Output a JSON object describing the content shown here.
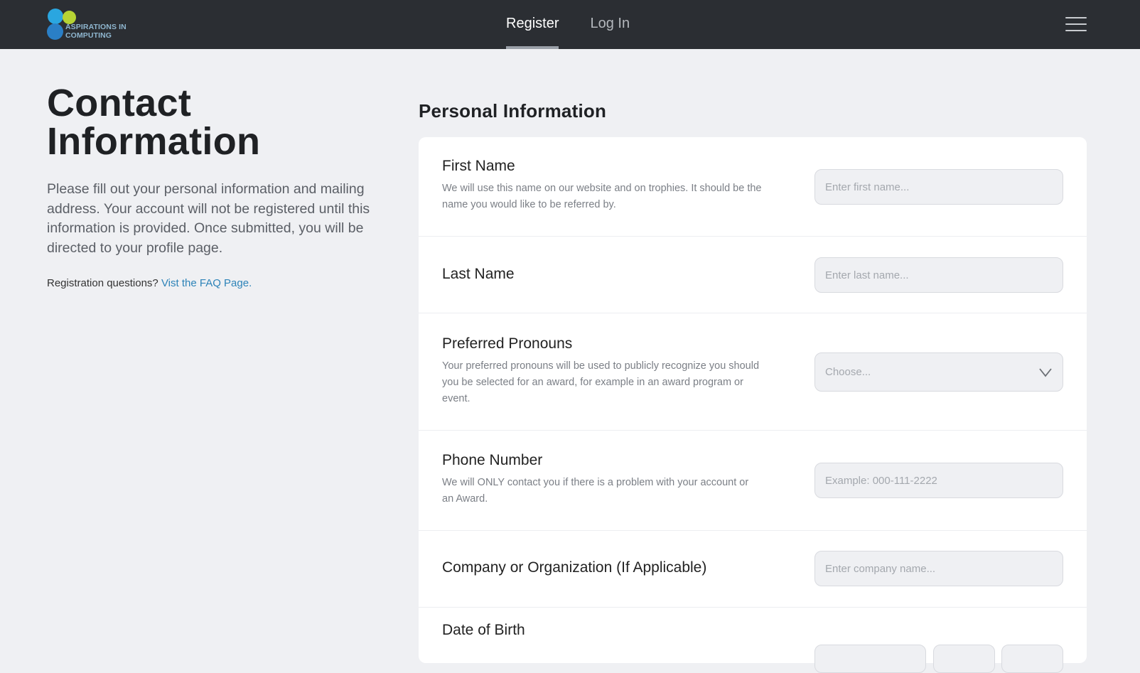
{
  "header": {
    "logo_text_line1": "ASPIRATIONS IN",
    "logo_text_line2": "COMPUTING",
    "nav": [
      {
        "label": "Register",
        "active": true
      },
      {
        "label": "Log In",
        "active": false
      }
    ],
    "menu_icon": "hamburger-icon"
  },
  "intro": {
    "title_line1": "Contact",
    "title_line2": "Information",
    "description": "Please fill out your personal information and mailing address. Your account will not be registered until this information is provided. Once submitted, you will be directed to your profile page.",
    "faq_prefix": "Registration questions?",
    "faq_link": "Vist the FAQ Page."
  },
  "form": {
    "section_title": "Personal Information",
    "first_name": {
      "label": "First Name",
      "help": "We will use this name on our website and on trophies. It should be the name you would like to be referred by.",
      "placeholder": "Enter first name..."
    },
    "last_name": {
      "label": "Last Name",
      "placeholder": "Enter last name..."
    },
    "pronouns": {
      "label": "Preferred Pronouns",
      "help": "Your preferred pronouns will be used to publicly recognize you should you be selected for an award, for example in an award program or event.",
      "selected": "Choose..."
    },
    "phone": {
      "label": "Phone Number",
      "help": "We will ONLY contact you if there is a problem with your account or an Award.",
      "placeholder": "Example: 000-111-2222"
    },
    "company": {
      "label": "Company or Organization (If Applicable)",
      "placeholder": "Enter company name..."
    },
    "dob": {
      "label": "Date of Birth"
    }
  },
  "colors": {
    "header_bg": "#2b2e33",
    "page_bg": "#eff0f3",
    "link": "#2d83b8",
    "logo_blue": "#2aa6e0",
    "logo_green": "#b6d334",
    "logo_darkblue": "#2a7fc6"
  }
}
